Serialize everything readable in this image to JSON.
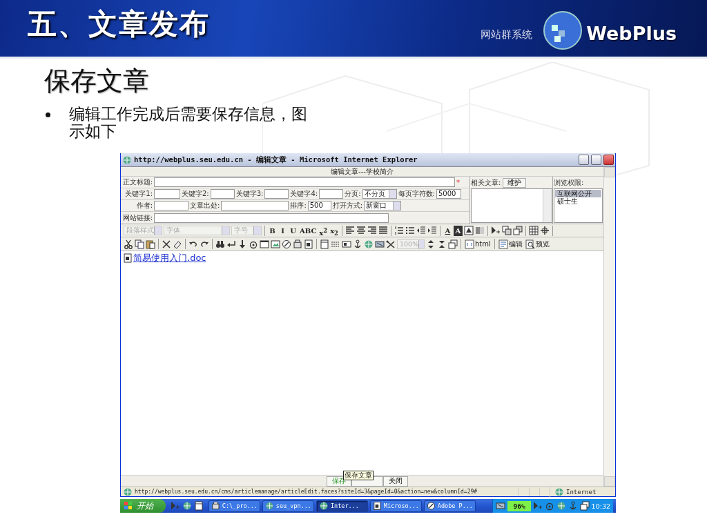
{
  "slide": {
    "header_title": "五、文章发布",
    "brand_tagline": "网站群系统",
    "brand_name": "WebPlus",
    "heading": "保存文章",
    "bullets": [
      "编辑工作完成后需要保存信息，图示如下"
    ]
  },
  "window": {
    "title": "http://webplus.seu.edu.cn - 编辑文章 - Microsoft Internet Explorer"
  },
  "form": {
    "caption": "编辑文章---学校简介",
    "title_label": "正文标题:",
    "required_mark": "*",
    "keyword_labels": [
      "关键字1:",
      "关键字2:",
      "关键字3:",
      "关键字4:"
    ],
    "paging_label": "分页:",
    "paging_value": "不分页",
    "chars_label": "每页字符数:",
    "chars_value": "5000",
    "author_label": "作者:",
    "source_label": "文章出处:",
    "order_label": "排序:",
    "order_value": "500",
    "open_label": "打开方式:",
    "open_value": "新窗口",
    "link_label": "网站链接:",
    "related_label": "相关文章:",
    "related_button": "维护",
    "permission_label": "浏览权限:",
    "permissions": [
      {
        "label": "互联网公开",
        "selected": true
      },
      {
        "label": "硕士生",
        "selected": false
      }
    ]
  },
  "toolbar_1": {
    "selects": [
      {
        "label": "段落样式",
        "disabled": true
      },
      {
        "label": "字体",
        "disabled": true
      },
      {
        "label": "字号",
        "disabled": true
      }
    ],
    "format_buttons": [
      "B",
      "I",
      "U",
      "ABC",
      "x$^{2}$",
      "x$_{2}$"
    ],
    "color_buttons": [
      "A",
      "A"
    ]
  },
  "toolbar_2": {
    "zoom": {
      "label": "100%",
      "disabled": true
    },
    "buttons": [
      "html",
      "编辑",
      "预览"
    ]
  },
  "content": {
    "attachment": "简易使用入门.doc"
  },
  "bottom_buttons": [
    {
      "label": "保存",
      "highlight": true
    },
    {
      "label": "关闭",
      "highlight": false
    }
  ],
  "tooltip": "保存文章",
  "status_bar": {
    "url": "http://webplus.seu.edu.cn/cms/articlemanage/articleEdit.faces?siteId=3&pageId=0&action=new&columnId=29#",
    "zone": "Internet"
  },
  "taskbar": {
    "start": "开始",
    "tasks": [
      {
        "label": "C:\\_pro...",
        "selected": false
      },
      {
        "label": "seu_vpn...",
        "selected": false
      },
      {
        "label": "Inter...",
        "selected": true
      },
      {
        "label": "Microso...",
        "selected": false
      },
      {
        "label": "Adobe P...",
        "selected": false
      }
    ],
    "battery": "96%",
    "clock": "10:32"
  }
}
